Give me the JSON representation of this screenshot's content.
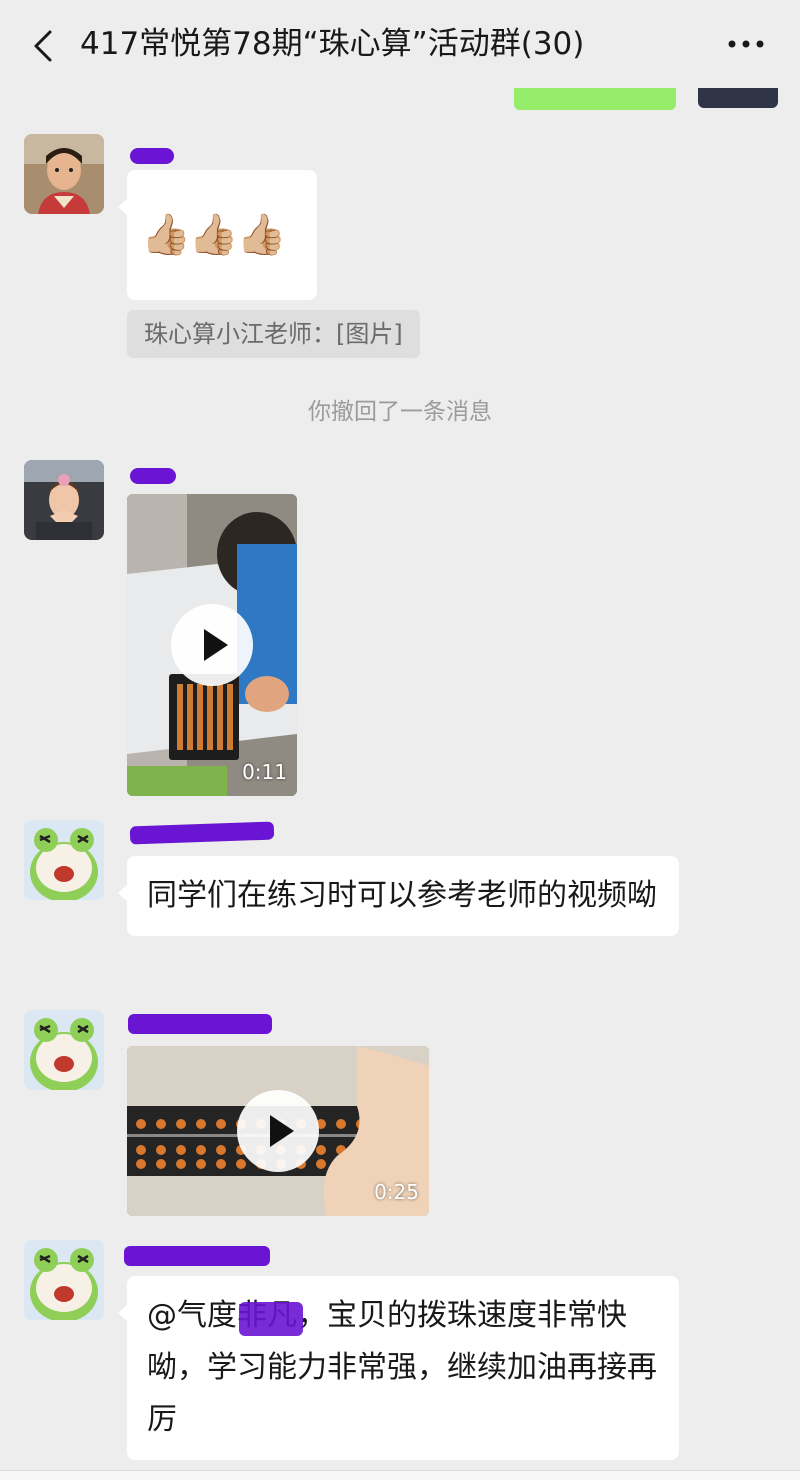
{
  "header": {
    "title": "417常悦第78期“珠心算”活动群(30)",
    "back_icon": "chevron-left-icon",
    "more_icon": "more-dots-icon"
  },
  "messages": [
    {
      "type": "emoji",
      "emoji_text": "👍🏼👍🏼👍🏼",
      "quote": "珠心算小江老师：[图片]"
    },
    {
      "type": "system",
      "text": "你撤回了一条消息"
    },
    {
      "type": "video",
      "duration": "0:11"
    },
    {
      "type": "text",
      "text": "同学们在练习时可以参考老师的视频呦"
    },
    {
      "type": "video",
      "duration": "0:25"
    },
    {
      "type": "text",
      "text": "@气度非凡，宝贝的拨珠速度非常快呦，学习能力非常强，继续加油再接再厉"
    }
  ],
  "colors": {
    "background": "#ededed",
    "bubble": "#ffffff",
    "sent_bubble": "#95ec69",
    "redaction": "#6a14d4"
  }
}
